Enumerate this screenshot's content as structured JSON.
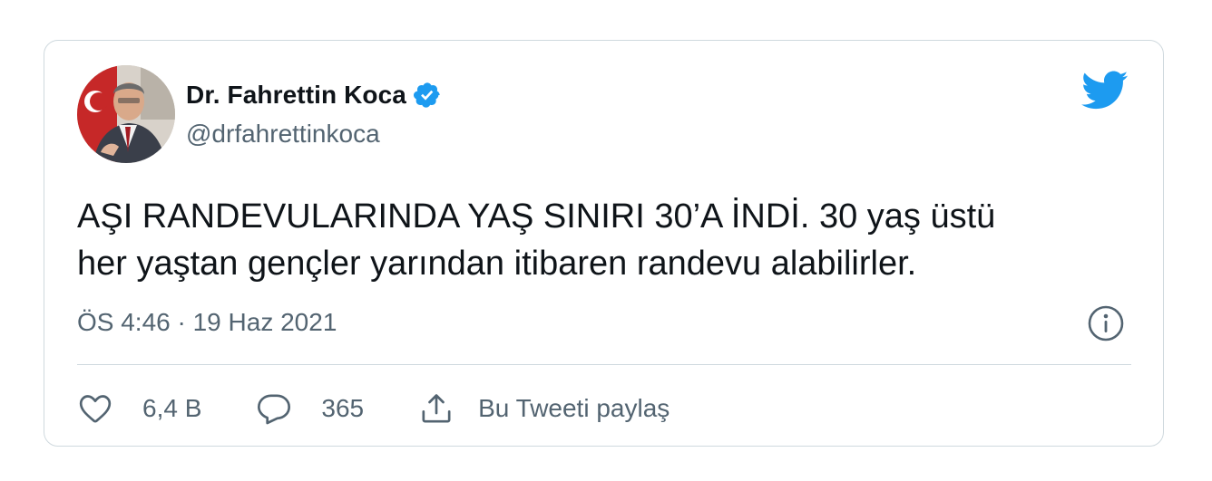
{
  "author": {
    "display_name": "Dr. Fahrettin Koca",
    "handle": "@drfahrettinkoca",
    "verified": true
  },
  "tweet": {
    "text_lines": [
      "AŞI RANDEVULARINDA YAŞ SINIRI 30’A İNDİ. 30 yaş üstü",
      "her yaştan gençler yarından itibaren randevu alabilirler."
    ],
    "timestamp": "ÖS 4:46 · 19 Haz 2021"
  },
  "actions": {
    "like_count": "6,4 B",
    "reply_count": "365",
    "share_label": "Bu Tweeti paylaş"
  },
  "icons": {
    "brand": "twitter-bird-icon",
    "verified": "verified-badge-icon",
    "info": "info-icon",
    "like": "heart-icon",
    "reply": "comment-icon",
    "share": "share-icon"
  },
  "colors": {
    "brand_blue": "#1d9bf0",
    "text_primary": "#0f1419",
    "text_secondary": "#536471",
    "border": "#cfd9de"
  }
}
